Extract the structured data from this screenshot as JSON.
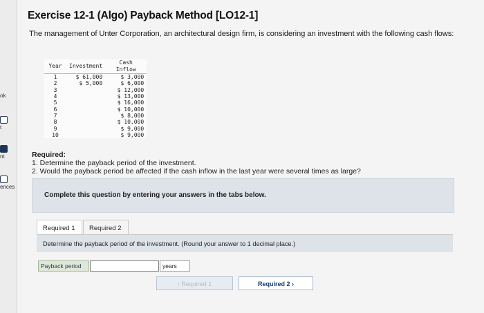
{
  "sidebar": {
    "items": [
      {
        "label": "ok"
      },
      {
        "label": "t"
      },
      {
        "label": "nt"
      },
      {
        "label": "ences"
      }
    ]
  },
  "title": "Exercise 12-1 (Algo) Payback Method [LO12-1]",
  "intro": "The management of Unter Corporation, an architectural design firm, is considering an investment with the following cash flows:",
  "cash_flow_table": {
    "headers": [
      "Year",
      "Investment",
      "Cash Inflow"
    ],
    "rows": [
      {
        "year": "1",
        "investment": "$ 61,000",
        "inflow": "$ 3,000"
      },
      {
        "year": "2",
        "investment": "$ 5,000",
        "inflow": "$ 6,000"
      },
      {
        "year": "3",
        "investment": "",
        "inflow": "$ 12,000"
      },
      {
        "year": "4",
        "investment": "",
        "inflow": "$ 13,000"
      },
      {
        "year": "5",
        "investment": "",
        "inflow": "$ 16,000"
      },
      {
        "year": "6",
        "investment": "",
        "inflow": "$ 10,000"
      },
      {
        "year": "7",
        "investment": "",
        "inflow": "$ 8,000"
      },
      {
        "year": "8",
        "investment": "",
        "inflow": "$ 10,000"
      },
      {
        "year": "9",
        "investment": "",
        "inflow": "$ 9,000"
      },
      {
        "year": "10",
        "investment": "",
        "inflow": "$ 9,000"
      }
    ]
  },
  "required": {
    "heading": "Required:",
    "items": [
      "1. Determine the payback period of the investment.",
      "2. Would the payback period be affected if the cash inflow in the last year were several times as large?"
    ]
  },
  "complete_text": "Complete this question by entering your answers in the tabs below.",
  "tabs": [
    {
      "label": "Required 1",
      "active": true
    },
    {
      "label": "Required 2",
      "active": false
    }
  ],
  "tab_instruction": "Determine the payback period of the investment. (Round your answer to 1 decimal place.)",
  "answer": {
    "label": "Payback period",
    "value": "",
    "unit": "years"
  },
  "nav": {
    "prev_label": "‹  Required 1",
    "next_label": "Required 2  ›"
  }
}
